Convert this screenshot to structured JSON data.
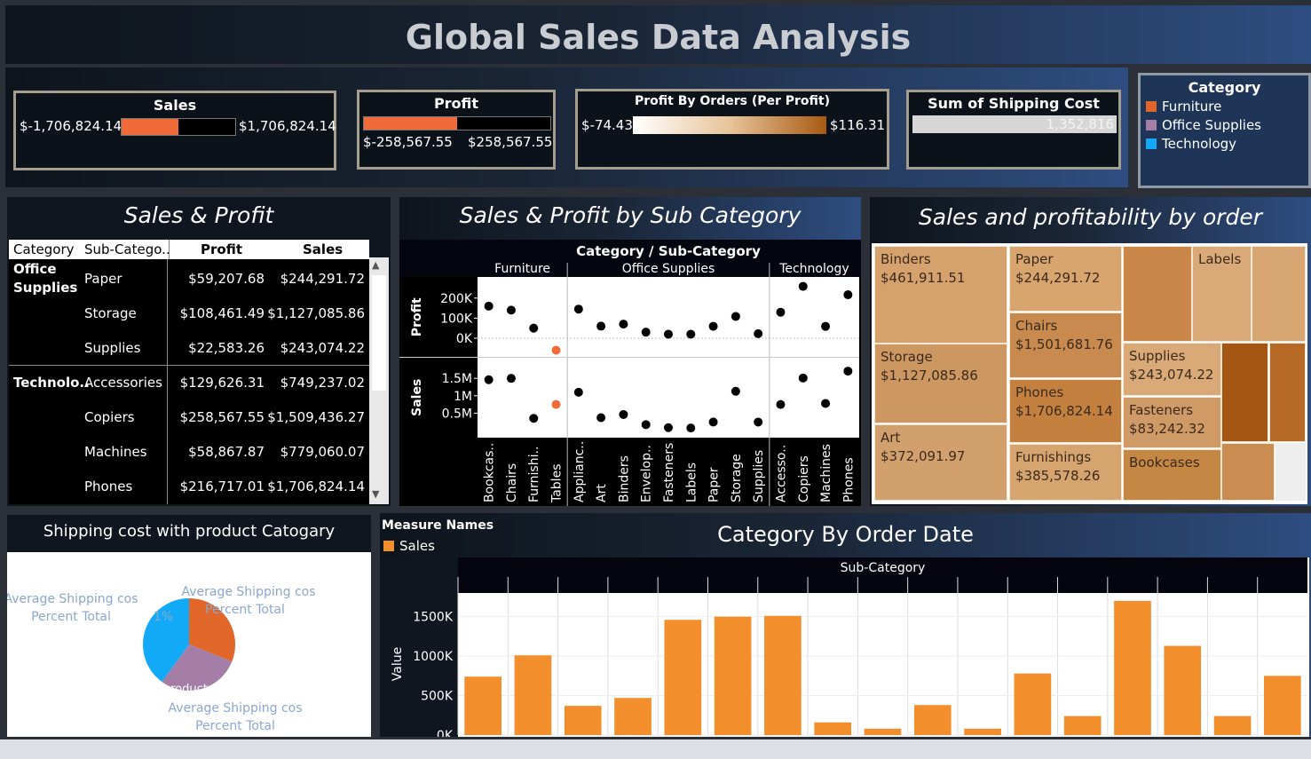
{
  "title": "Global Sales Data Analysis",
  "colors": {
    "furniture": "#e0662a",
    "office_supplies": "#a57ea8",
    "technology": "#12aaf7",
    "bar_orange": "#f28e2b",
    "accent_red": "#f06a3a"
  },
  "kpi": {
    "sales": {
      "title": "Sales",
      "min": "$-1,706,824.14",
      "max": "$1,706,824.14",
      "fill_fraction": 0.5
    },
    "profit": {
      "title": "Profit",
      "min": "$-258,567.55",
      "max": "$258,567.55",
      "fill_fraction": 0.5
    },
    "profit_orders": {
      "title": "Profit By Orders (Per Profit)",
      "min": "$-74.43",
      "max": "$116.31"
    },
    "shipping": {
      "title": "Sum of Shipping Cost",
      "value": "1,352,816"
    }
  },
  "legend": {
    "title": "Category",
    "items": [
      {
        "label": "Furniture",
        "color": "#e0662a"
      },
      {
        "label": "Office Supplies",
        "color": "#a57ea8"
      },
      {
        "label": "Technology",
        "color": "#12aaf7"
      }
    ]
  },
  "sales_profit_table": {
    "title": "Sales & Profit",
    "headers": [
      "Category",
      "Sub-Catego..",
      "Profit",
      "Sales"
    ],
    "groups": [
      {
        "category": "Office Supplies",
        "rows": [
          {
            "sub": "Paper",
            "profit": "$59,207.68",
            "sales": "$244,291.72"
          },
          {
            "sub": "Storage",
            "profit": "$108,461.49",
            "sales": "$1,127,085.86"
          },
          {
            "sub": "Supplies",
            "profit": "$22,583.26",
            "sales": "$243,074.22"
          }
        ]
      },
      {
        "category": "Technolo..",
        "rows": [
          {
            "sub": "Accessories",
            "profit": "$129,626.31",
            "sales": "$749,237.02"
          },
          {
            "sub": "Copiers",
            "profit": "$258,567.55",
            "sales": "$1,509,436.27"
          },
          {
            "sub": "Machines",
            "profit": "$58,867.87",
            "sales": "$779,060.07"
          },
          {
            "sub": "Phones",
            "profit": "$216,717.01",
            "sales": "$1,706,824.14"
          }
        ]
      }
    ]
  },
  "chart_data": [
    {
      "type": "scatter",
      "title": "Sales & Profit by Sub Category",
      "header": "Category / Sub-Category",
      "groups": [
        "Furniture",
        "Office Supplies",
        "Technology"
      ],
      "categories": [
        "Bookcas..",
        "Chairs",
        "Furnishi..",
        "Tables",
        "Applianc..",
        "Art",
        "Binders",
        "Envelop..",
        "Fasteners",
        "Labels",
        "Paper",
        "Storage",
        "Supplies",
        "Accesso..",
        "Copiers",
        "Machines",
        "Phones"
      ],
      "group_sizes": [
        4,
        9,
        4
      ],
      "rows": [
        {
          "label": "Profit",
          "ticks": [
            "200K",
            "100K",
            "0K"
          ],
          "ylim": [
            -60000,
            270000
          ],
          "values": [
            160000,
            140000,
            50000,
            -60000,
            145000,
            60000,
            70000,
            30000,
            20000,
            20000,
            59207,
            108461,
            22583,
            129626,
            258567,
            58867,
            216717
          ]
        },
        {
          "label": "Sales",
          "ticks": [
            "1.5M",
            "1M",
            "0.5M"
          ],
          "ylim": [
            0,
            1900000
          ],
          "values": [
            1460000,
            1500000,
            350000,
            750000,
            1100000,
            370000,
            460000,
            170000,
            83000,
            73000,
            244291,
            1127085,
            243074,
            749237,
            1509436,
            779060,
            1706824
          ]
        }
      ],
      "negative_color": "#f06a3a"
    },
    {
      "type": "treemap",
      "title": "Sales and profitability by order",
      "items": [
        {
          "label": "Binders",
          "value": "$461,911.51"
        },
        {
          "label": "Paper",
          "value": "$244,291.72"
        },
        {
          "label": "Labels",
          "value": ""
        },
        {
          "label": "Storage",
          "value": "$1,127,085.86"
        },
        {
          "label": "Chairs",
          "value": "$1,501,681.76"
        },
        {
          "label": "Supplies",
          "value": "$243,074.22"
        },
        {
          "label": "Phones",
          "value": "$1,706,824.14"
        },
        {
          "label": "Fasteners",
          "value": "$83,242.32"
        },
        {
          "label": "Art",
          "value": "$372,091.97"
        },
        {
          "label": "Furnishings",
          "value": "$385,578.26"
        },
        {
          "label": "Bookcases",
          "value": ""
        }
      ]
    },
    {
      "type": "pie",
      "title": "Shipping cost with product Catogary",
      "slices": [
        {
          "category": "Furniture",
          "value": 31,
          "color": "#e0662a"
        },
        {
          "category": "Office Supplies",
          "value": 29,
          "color": "#a57ea8"
        },
        {
          "category": "Technology",
          "value": 40,
          "color": "#12aaf7"
        }
      ],
      "labels": [
        "Average Shipping cos",
        "Percent Total"
      ],
      "partial_texts": [
        "1%",
        "roduct"
      ]
    },
    {
      "type": "bar",
      "title": "Category By Order Date",
      "legend_title": "Measure Names",
      "series": [
        {
          "name": "Sales",
          "values": [
            740000,
            1010000,
            370000,
            470000,
            1460000,
            1500000,
            1510000,
            160000,
            80000,
            380000,
            80000,
            780000,
            240000,
            1700000,
            1130000,
            240000,
            750000
          ]
        }
      ],
      "column_header": "Sub-Category",
      "ylabel": "Value",
      "yticks": [
        "1500K",
        "1000K",
        "500K",
        "0K"
      ],
      "ylim": [
        0,
        1800000
      ]
    }
  ]
}
